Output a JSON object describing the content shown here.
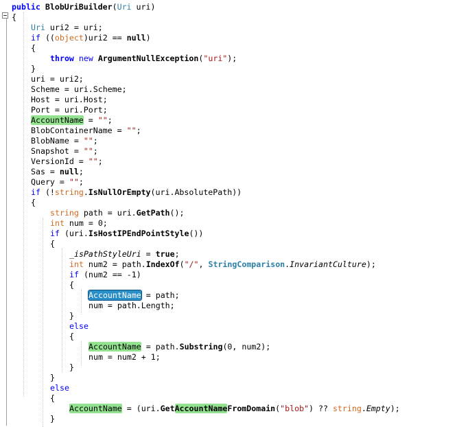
{
  "editor": {
    "language": "C#",
    "highlight_colors": {
      "reference": "#92e28f",
      "selected_reference": "#2a8fc7"
    },
    "lines": [
      {
        "indent": 0,
        "tokens": [
          {
            "t": "public ",
            "c": "kw b"
          },
          {
            "t": "BlobUriBuilder",
            "c": "b"
          },
          {
            "t": "(",
            "c": ""
          },
          {
            "t": "Uri",
            "c": "ty"
          },
          {
            "t": " uri)",
            "c": ""
          }
        ]
      },
      {
        "indent": 0,
        "tokens": [
          {
            "t": "{",
            "c": ""
          }
        ]
      },
      {
        "indent": 1,
        "tokens": [
          {
            "t": "Uri",
            "c": "ty"
          },
          {
            "t": " uri2 = uri;",
            "c": ""
          }
        ]
      },
      {
        "indent": 1,
        "tokens": [
          {
            "t": "if",
            "c": "kw"
          },
          {
            "t": " ((",
            "c": ""
          },
          {
            "t": "object",
            "c": "kwd"
          },
          {
            "t": ")uri2 == ",
            "c": ""
          },
          {
            "t": "null",
            "c": "nul"
          },
          {
            "t": ")",
            "c": ""
          }
        ]
      },
      {
        "indent": 1,
        "tokens": [
          {
            "t": "{",
            "c": ""
          }
        ]
      },
      {
        "indent": 2,
        "tokens": [
          {
            "t": "throw ",
            "c": "kw b"
          },
          {
            "t": "new ",
            "c": "kw"
          },
          {
            "t": "ArgumentNullException",
            "c": "b"
          },
          {
            "t": "(",
            "c": ""
          },
          {
            "t": "\"uri\"",
            "c": "str"
          },
          {
            "t": ");",
            "c": ""
          }
        ]
      },
      {
        "indent": 1,
        "tokens": [
          {
            "t": "}",
            "c": ""
          }
        ]
      },
      {
        "indent": 1,
        "tokens": [
          {
            "t": "uri = uri2;",
            "c": ""
          }
        ]
      },
      {
        "indent": 1,
        "tokens": [
          {
            "t": "Scheme = uri.Scheme;",
            "c": ""
          }
        ]
      },
      {
        "indent": 1,
        "tokens": [
          {
            "t": "Host = uri.Host;",
            "c": ""
          }
        ]
      },
      {
        "indent": 1,
        "tokens": [
          {
            "t": "Port = uri.Port;",
            "c": ""
          }
        ]
      },
      {
        "indent": 1,
        "tokens": [
          {
            "t": "AccountName",
            "c": "ref"
          },
          {
            "t": " = ",
            "c": ""
          },
          {
            "t": "\"\"",
            "c": "str"
          },
          {
            "t": ";",
            "c": ""
          }
        ]
      },
      {
        "indent": 1,
        "tokens": [
          {
            "t": "BlobContainerName = ",
            "c": ""
          },
          {
            "t": "\"\"",
            "c": "str"
          },
          {
            "t": ";",
            "c": ""
          }
        ]
      },
      {
        "indent": 1,
        "tokens": [
          {
            "t": "BlobName = ",
            "c": ""
          },
          {
            "t": "\"\"",
            "c": "str"
          },
          {
            "t": ";",
            "c": ""
          }
        ]
      },
      {
        "indent": 1,
        "tokens": [
          {
            "t": "Snapshot = ",
            "c": ""
          },
          {
            "t": "\"\"",
            "c": "str"
          },
          {
            "t": ";",
            "c": ""
          }
        ]
      },
      {
        "indent": 1,
        "tokens": [
          {
            "t": "VersionId = ",
            "c": ""
          },
          {
            "t": "\"\"",
            "c": "str"
          },
          {
            "t": ";",
            "c": ""
          }
        ]
      },
      {
        "indent": 1,
        "tokens": [
          {
            "t": "Sas = ",
            "c": ""
          },
          {
            "t": "null",
            "c": "nul"
          },
          {
            "t": ";",
            "c": ""
          }
        ]
      },
      {
        "indent": 1,
        "tokens": [
          {
            "t": "Query = ",
            "c": ""
          },
          {
            "t": "\"\"",
            "c": "str"
          },
          {
            "t": ";",
            "c": ""
          }
        ]
      },
      {
        "indent": 1,
        "tokens": [
          {
            "t": "if",
            "c": "kw"
          },
          {
            "t": " (!",
            "c": ""
          },
          {
            "t": "string",
            "c": "kwd"
          },
          {
            "t": ".",
            "c": ""
          },
          {
            "t": "IsNullOrEmpty",
            "c": "mth"
          },
          {
            "t": "(uri.AbsolutePath))",
            "c": ""
          }
        ]
      },
      {
        "indent": 1,
        "tokens": [
          {
            "t": "{",
            "c": ""
          }
        ]
      },
      {
        "indent": 2,
        "tokens": [
          {
            "t": "string",
            "c": "kwd"
          },
          {
            "t": " path = uri.",
            "c": ""
          },
          {
            "t": "GetPath",
            "c": "mth"
          },
          {
            "t": "();",
            "c": ""
          }
        ]
      },
      {
        "indent": 2,
        "tokens": [
          {
            "t": "int",
            "c": "kwd"
          },
          {
            "t": " num = 0;",
            "c": ""
          }
        ]
      },
      {
        "indent": 2,
        "tokens": [
          {
            "t": "if",
            "c": "kw"
          },
          {
            "t": " (uri.",
            "c": ""
          },
          {
            "t": "IsHostIPEndPointStyle",
            "c": "mth"
          },
          {
            "t": "())",
            "c": ""
          }
        ]
      },
      {
        "indent": 2,
        "tokens": [
          {
            "t": "{",
            "c": ""
          }
        ]
      },
      {
        "indent": 3,
        "tokens": [
          {
            "t": "_isPathStyleUri",
            "c": "it"
          },
          {
            "t": " = ",
            "c": ""
          },
          {
            "t": "true",
            "c": "nul"
          },
          {
            "t": ";",
            "c": ""
          }
        ]
      },
      {
        "indent": 3,
        "tokens": [
          {
            "t": "int",
            "c": "kwd"
          },
          {
            "t": " num2 = path.",
            "c": ""
          },
          {
            "t": "IndexOf",
            "c": "mth"
          },
          {
            "t": "(",
            "c": ""
          },
          {
            "t": "\"/\"",
            "c": "str"
          },
          {
            "t": ", ",
            "c": ""
          },
          {
            "t": "StringComparison",
            "c": "cty b"
          },
          {
            "t": ".",
            "c": ""
          },
          {
            "t": "InvariantCulture",
            "c": "it"
          },
          {
            "t": ");",
            "c": ""
          }
        ]
      },
      {
        "indent": 3,
        "tokens": [
          {
            "t": "if",
            "c": "kw"
          },
          {
            "t": " (num2 == -1)",
            "c": ""
          }
        ]
      },
      {
        "indent": 3,
        "tokens": [
          {
            "t": "{",
            "c": ""
          }
        ]
      },
      {
        "indent": 4,
        "tokens": [
          {
            "t": "AccountName",
            "c": "refsel"
          },
          {
            "t": " = path;",
            "c": ""
          }
        ]
      },
      {
        "indent": 4,
        "tokens": [
          {
            "t": "num = path.Length;",
            "c": ""
          }
        ]
      },
      {
        "indent": 3,
        "tokens": [
          {
            "t": "}",
            "c": ""
          }
        ]
      },
      {
        "indent": 3,
        "tokens": [
          {
            "t": "else",
            "c": "kw"
          }
        ]
      },
      {
        "indent": 3,
        "tokens": [
          {
            "t": "{",
            "c": ""
          }
        ]
      },
      {
        "indent": 4,
        "tokens": [
          {
            "t": "AccountName",
            "c": "ref"
          },
          {
            "t": " = path.",
            "c": ""
          },
          {
            "t": "Substring",
            "c": "mth"
          },
          {
            "t": "(0, num2);",
            "c": ""
          }
        ]
      },
      {
        "indent": 4,
        "tokens": [
          {
            "t": "num = num2 + 1;",
            "c": ""
          }
        ]
      },
      {
        "indent": 3,
        "tokens": [
          {
            "t": "}",
            "c": ""
          }
        ]
      },
      {
        "indent": 2,
        "tokens": [
          {
            "t": "}",
            "c": ""
          }
        ]
      },
      {
        "indent": 2,
        "tokens": [
          {
            "t": "else",
            "c": "kw"
          }
        ]
      },
      {
        "indent": 2,
        "tokens": [
          {
            "t": "{",
            "c": ""
          }
        ]
      },
      {
        "indent": 3,
        "tokens": [
          {
            "t": "AccountName",
            "c": "ref"
          },
          {
            "t": " = (uri.",
            "c": ""
          },
          {
            "t": "Get",
            "c": "mth"
          },
          {
            "t": "AccountName",
            "c": "ref mth"
          },
          {
            "t": "FromDomain",
            "c": "mth"
          },
          {
            "t": "(",
            "c": ""
          },
          {
            "t": "\"blob\"",
            "c": "str"
          },
          {
            "t": ") ?? ",
            "c": ""
          },
          {
            "t": "string",
            "c": "kwd"
          },
          {
            "t": ".",
            "c": ""
          },
          {
            "t": "Empty",
            "c": "it"
          },
          {
            "t": ");",
            "c": ""
          }
        ]
      },
      {
        "indent": 2,
        "tokens": [
          {
            "t": "}",
            "c": ""
          }
        ]
      }
    ]
  }
}
